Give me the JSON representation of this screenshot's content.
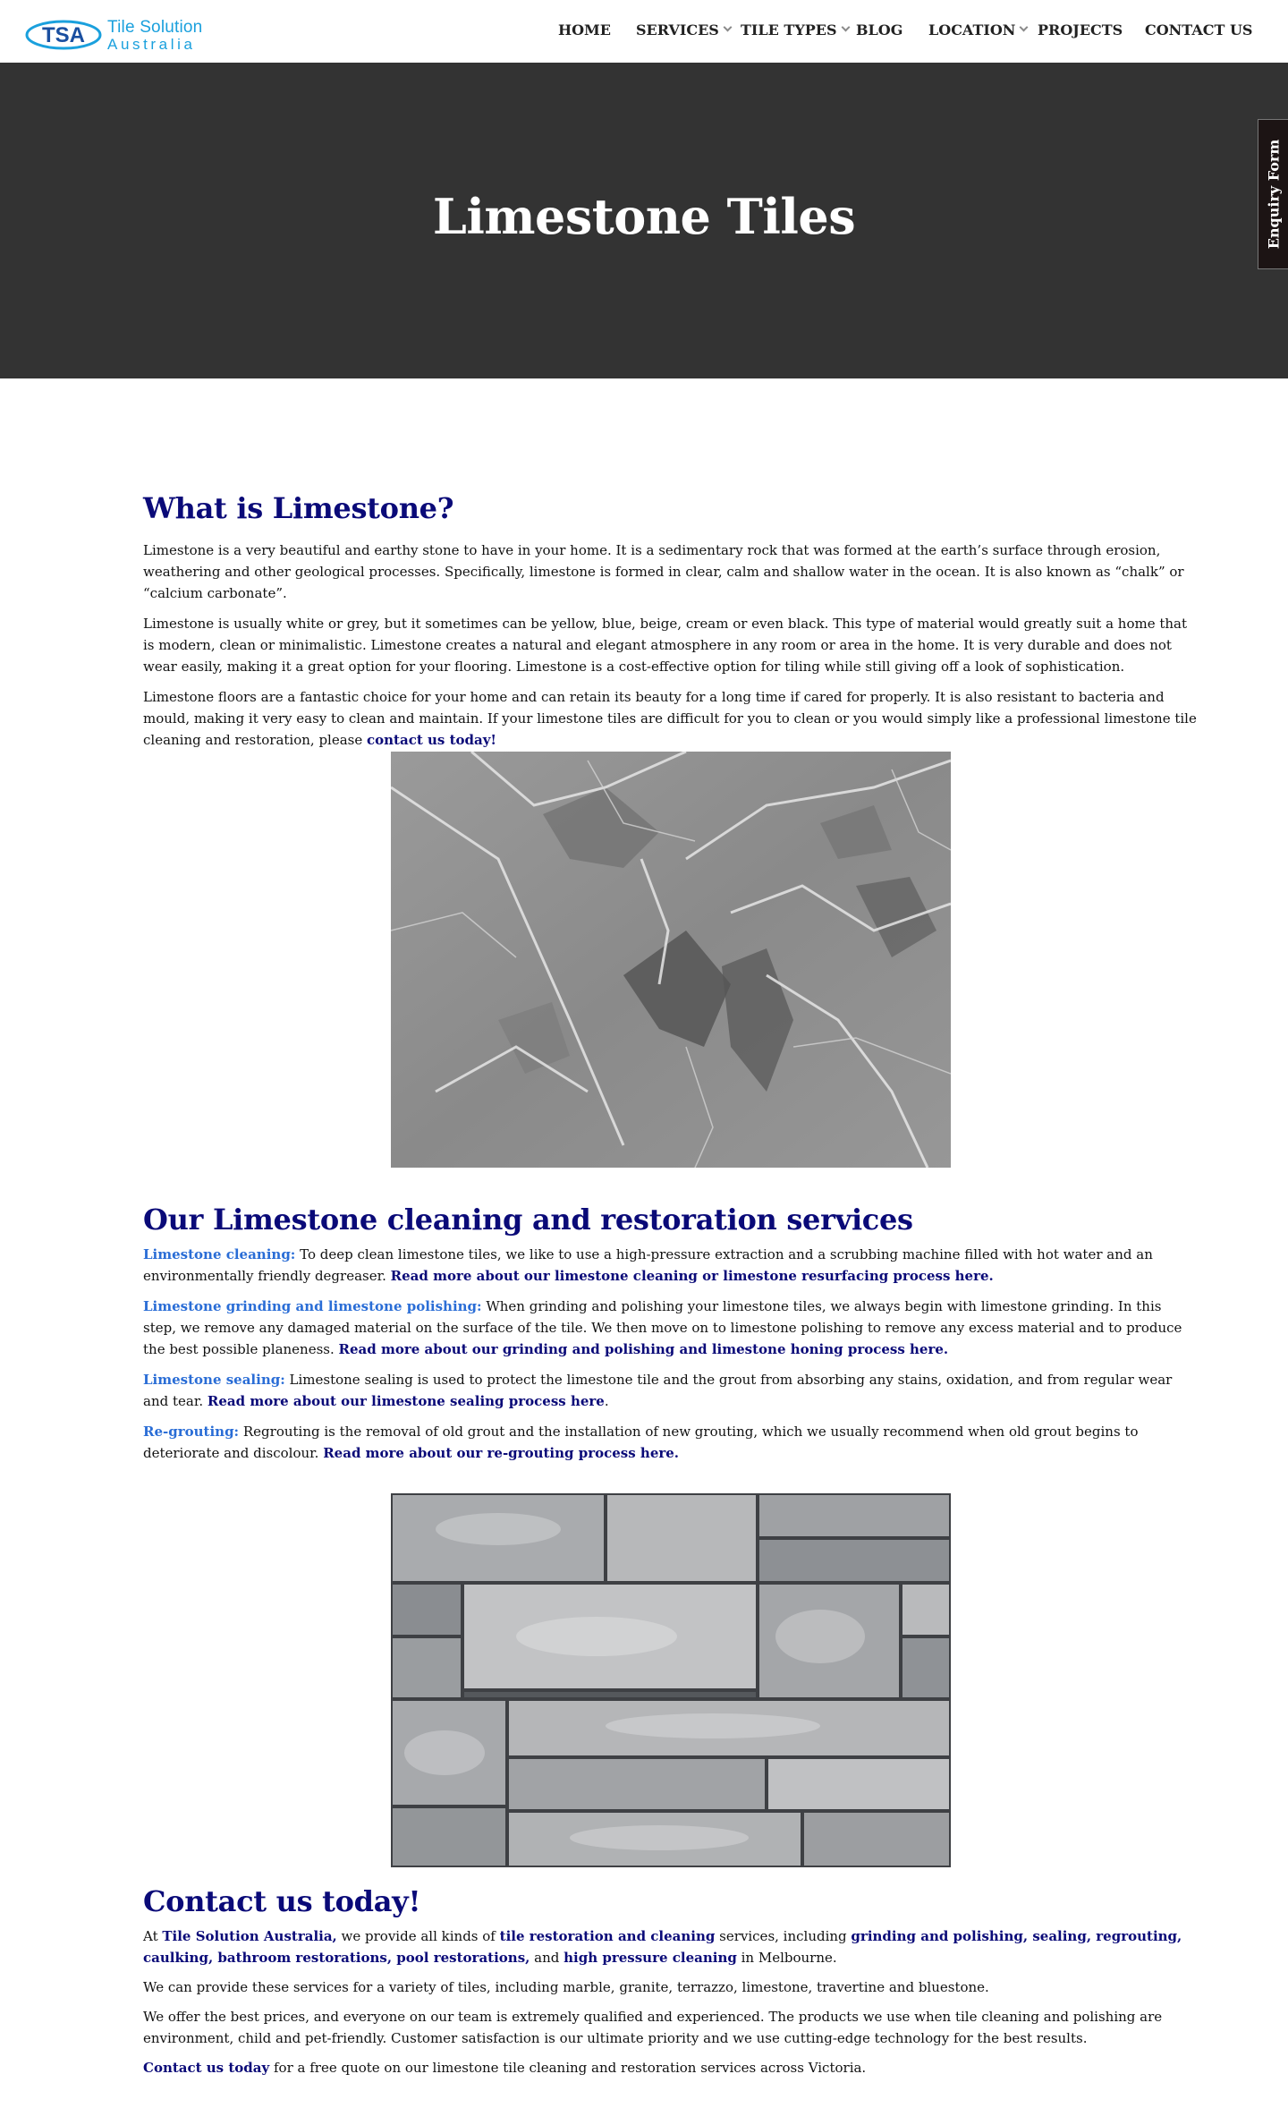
{
  "header": {
    "logo": {
      "mark_text": "TSA",
      "line1": "Tile Solution",
      "line2": "Australia"
    },
    "nav": [
      {
        "label": "HOME",
        "has_dropdown": false
      },
      {
        "label": "SERVICES",
        "has_dropdown": true
      },
      {
        "label": "TILE TYPES",
        "has_dropdown": true
      },
      {
        "label": "BLOG",
        "has_dropdown": false
      },
      {
        "label": "LOCATION",
        "has_dropdown": true
      },
      {
        "label": "PROJECTS",
        "has_dropdown": false
      },
      {
        "label": "CONTACT US",
        "has_dropdown": false
      }
    ]
  },
  "hero": {
    "title": "Limestone Tiles",
    "enquiry_tab": "Enquiry Form"
  },
  "section1": {
    "heading": "What is Limestone?",
    "p1": "Limestone is a very beautiful and earthy stone to have in your home. It is a sedimentary rock that was formed at the earth’s surface through erosion, weathering and other geological processes. Specifically, limestone is formed in clear, calm and shallow water in the ocean. It is also known as “chalk” or “calcium carbonate”.",
    "p2": "Limestone is usually white or grey, but it sometimes can be yellow, blue, beige, cream or even black. This type of material would greatly suit a home that is modern, clean or minimalistic. Limestone creates a natural and elegant atmosphere in any room or area in the home. It is very durable and does not wear easily, making it a great option for your flooring. Limestone is a cost-effective option for tiling while still giving off a look of sophistication.",
    "p3_text": "Limestone floors are a fantastic choice for your home and can retain its beauty for a long time if cared for properly. It is also resistant to bacteria and mould, making it very easy to clean and maintain. If your limestone tiles are difficult for you to clean or you would simply like a professional limestone tile cleaning and restoration, please ",
    "p3_link": "contact us today!"
  },
  "section2": {
    "heading": "Our Limestone cleaning and restoration services",
    "items": [
      {
        "label": "Limestone cleaning:",
        "text": " To deep clean limestone tiles, we like to use a high-pressure extraction and a scrubbing machine filled with hot water and an environmentally friendly degreaser. ",
        "link": "Read more about our limestone cleaning or limestone resurfacing process here.",
        "after": ""
      },
      {
        "label": "Limestone grinding and limestone polishing:",
        "text": " When grinding and polishing your limestone tiles, we always begin with limestone grinding. In this step, we remove any damaged material on the surface of the tile. We then move on to limestone polishing to remove any excess material and to produce the best possible planeness. ",
        "link": "Read more about our grinding and polishing and limestone honing process here.",
        "after": ""
      },
      {
        "label": "Limestone sealing:",
        "text": " Limestone sealing is used to protect the limestone tile and the grout from absorbing any stains, oxidation, and from regular wear and tear. ",
        "link": "Read more about our limestone sealing process here",
        "after": "."
      },
      {
        "label": "Re-grouting:",
        "text": " Regrouting is the removal of old grout and the installation of new grouting, which we usually recommend when old grout begins to deteriorate and discolour. ",
        "link": "Read more about our re-grouting process here.",
        "after": ""
      }
    ]
  },
  "section3": {
    "heading": "Contact us today!",
    "p1": {
      "t1": "At ",
      "l1": "Tile Solution Australia,",
      "t2": " we provide all kinds of ",
      "l2": "tile restoration and cleaning",
      "t3": " services, including ",
      "l3": "grinding and polishing, sealing, regrouting, caulking, bathroom restorations, pool restorations,",
      "t4": " and ",
      "l4": "high pressure cleaning",
      "t5": " in Melbourne."
    },
    "p2": "We can provide these services for a variety of tiles, including marble, granite, terrazzo, limestone, travertine and bluestone.",
    "p3": "We offer the best prices, and everyone on our team is extremely qualified and experienced. The products we use when tile cleaning and polishing are environment, child and pet-friendly. Customer satisfaction is our ultimate priority and we use cutting-edge technology for the best results.",
    "p4_link": "Contact us today",
    "p4_text": " for a free quote on our limestone tile cleaning and restoration services across Victoria."
  },
  "colors": {
    "heading": "#0a0a78",
    "link": "#0a0a78",
    "service_label": "#2a6dd6",
    "hero_bg": "#333333",
    "logo": "#1aa0dd",
    "enquiry_bg": "#1c1414"
  }
}
